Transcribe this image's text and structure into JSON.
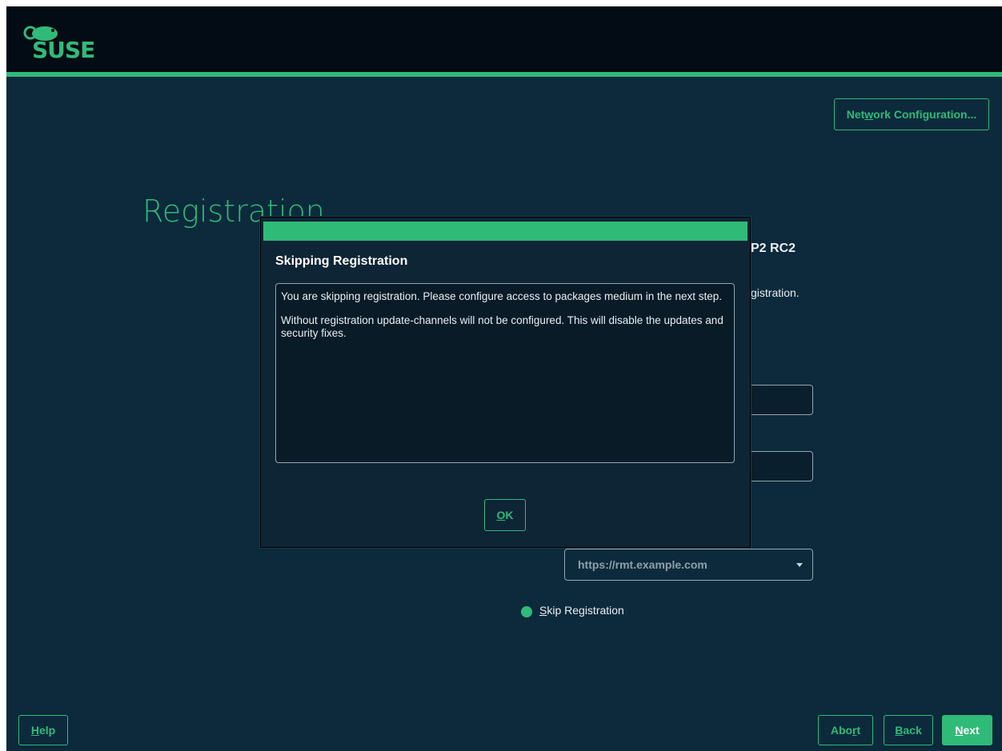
{
  "header": {
    "brand": "SUSE"
  },
  "colors": {
    "accent": "#30ba78",
    "background": "#0c2a3c",
    "topbar": "#030b14"
  },
  "buttons": {
    "network_config": {
      "pre": "Net",
      "key": "w",
      "post": "ork Configuration..."
    },
    "help": {
      "key": "H",
      "post": "elp"
    },
    "abort": {
      "pre": "Abo",
      "key": "r",
      "post": "t"
    },
    "back": {
      "key": "B",
      "post": "ack"
    },
    "next": {
      "key": "N",
      "post": "ext"
    }
  },
  "page": {
    "title": "Registration",
    "product_partial": "P2 RC2",
    "text_partial": "gistration.",
    "registration_server": "https://rmt.example.com",
    "skip_registration": {
      "key": "S",
      "post": "kip Registration"
    }
  },
  "dialog": {
    "title": "Skipping Registration",
    "paragraphs": [
      "You are skipping registration. Please configure access to packages medium in the next step.",
      "Without registration update-channels will not be configured. This will disable the updates and security fixes."
    ],
    "ok": {
      "key": "O",
      "post": "K"
    }
  },
  "icons": {
    "logo": "suse-chameleon-logo",
    "dropdown": "chevron-down-icon",
    "radio": "radio-selected-icon"
  }
}
